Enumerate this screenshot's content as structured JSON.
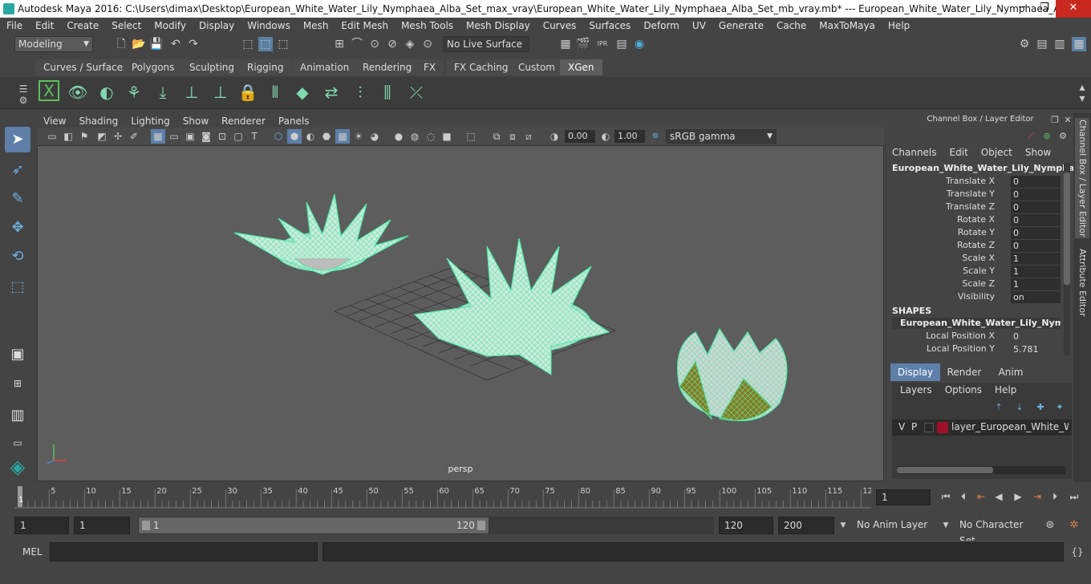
{
  "window": {
    "title": "Autodesk Maya 2016: C:\\Users\\dimax\\Desktop\\European_White_Water_Lily_Nymphaea_Alba_Set_max_vray\\European_White_Water_Lily_Nymphaea_Alba_Set_mb_vray.mb*  ---  European_White_Water_Lily_Nymphaea_Alba_Set_ncl...",
    "minimize": "─",
    "maximize": "❐",
    "close": "✕"
  },
  "menubar": [
    "File",
    "Edit",
    "Create",
    "Select",
    "Modify",
    "Display",
    "Windows",
    "Mesh",
    "Edit Mesh",
    "Mesh Tools",
    "Mesh Display",
    "Curves",
    "Surfaces",
    "Deform",
    "UV",
    "Generate",
    "Cache",
    "MaxToMaya",
    "Help"
  ],
  "statusline": {
    "menuset": "Modeling",
    "live_surface": "No Live Surface"
  },
  "shelf": {
    "tabs": [
      "Curves / Surfaces",
      "Polygons",
      "Sculpting",
      "Rigging",
      "Animation",
      "Rendering",
      "FX",
      "FX Caching",
      "Custom",
      "XGen"
    ],
    "active_tab": "XGen"
  },
  "viewport": {
    "menu": [
      "View",
      "Shading",
      "Lighting",
      "Show",
      "Renderer",
      "Panels"
    ],
    "exposure": "0.00",
    "gamma": "1.00",
    "colorspace": "sRGB gamma",
    "camera_label": "persp"
  },
  "channel_box": {
    "header": "Channel Box / Layer Editor",
    "menu": [
      "Channels",
      "Edit",
      "Object",
      "Show"
    ],
    "object_name": "European_White_Water_Lily_Nympha...",
    "attributes": [
      {
        "label": "Translate X",
        "value": "0"
      },
      {
        "label": "Translate Y",
        "value": "0"
      },
      {
        "label": "Translate Z",
        "value": "0"
      },
      {
        "label": "Rotate X",
        "value": "0"
      },
      {
        "label": "Rotate Y",
        "value": "0"
      },
      {
        "label": "Rotate Z",
        "value": "0"
      },
      {
        "label": "Scale X",
        "value": "1"
      },
      {
        "label": "Scale Y",
        "value": "1"
      },
      {
        "label": "Scale Z",
        "value": "1"
      },
      {
        "label": "Visibility",
        "value": "on"
      }
    ],
    "shapes_header": "SHAPES",
    "shape_name": "European_White_Water_Lily_Nymph...",
    "shape_attributes": [
      {
        "label": "Local Position X",
        "value": "0"
      },
      {
        "label": "Local Position Y",
        "value": "5.781"
      }
    ]
  },
  "layer_editor": {
    "tabs": [
      "Display",
      "Render",
      "Anim"
    ],
    "active_tab": "Display",
    "menu": [
      "Layers",
      "Options",
      "Help"
    ],
    "layer": {
      "v": "V",
      "p": "P",
      "name": "layer_European_White_Water",
      "color": "#a0102a"
    }
  },
  "side_tabs": [
    "Channel Box / Layer Editor",
    "Attribute Editor"
  ],
  "timeline": {
    "ticks": [
      "5",
      "10",
      "15",
      "20",
      "25",
      "30",
      "35",
      "40",
      "45",
      "50",
      "55",
      "60",
      "65",
      "70",
      "75",
      "80",
      "85",
      "90",
      "95",
      "100",
      "105",
      "110",
      "115",
      "12"
    ],
    "current_frame_marker": "1",
    "current_frame": "1"
  },
  "range": {
    "start": "1",
    "playback_start": "1",
    "slider_start": "1",
    "slider_end": "120",
    "playback_end": "120",
    "end": "200",
    "anim_layer": "No Anim Layer",
    "character_set": "No Character Set"
  },
  "cmdline": {
    "label": "MEL"
  }
}
